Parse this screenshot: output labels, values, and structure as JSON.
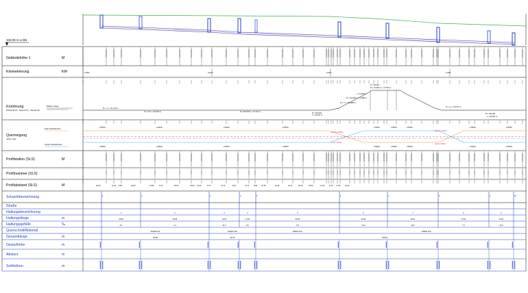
{
  "datum": "333.00 m ü.NN",
  "rows": {
    "gelaendehoehe": {
      "label": "Geländehöhe 1",
      "unit": "M"
    },
    "kilometrierung": {
      "label": "Kilometrierung",
      "unit": "KM"
    },
    "kruemmung": {
      "label": "Krümmung",
      "sub": "Hochpunkt (P) · Tiefpunkt (T) · Wende (W)",
      "legend": "Radius / Länge"
    },
    "querneigung": {
      "label": "Querneigung",
      "sub": "rechts / links",
      "legend_a": "linker Fahrbahnrand",
      "legend_b": "rechter Fahrbahnrand"
    },
    "profilstation": {
      "label": "Profilstation (SLS)",
      "unit": "M"
    },
    "profilnummer": {
      "label": "Profilnummer (SLS)"
    },
    "profilabstand": {
      "label": "Profilabstand (SLS)",
      "unit": "M"
    },
    "schacht": {
      "label": "Schachtbezeichnung"
    },
    "strasse": {
      "label": "Straße"
    },
    "haltung": {
      "label": "Haltungsbezeichnung"
    },
    "haltungslaenge": {
      "label": "Haltungslänge",
      "unit": "m"
    },
    "haltungsgefaelle": {
      "label": "Haltungsgefälle",
      "unit": "‰"
    },
    "querschnitt": {
      "label": "Querschnitt/Material"
    },
    "gesamtlaenge": {
      "label": "Gesamtlänge",
      "unit": "m"
    },
    "deckelhoehe": {
      "label": "Deckelhöhe",
      "unit": "m"
    },
    "absturz": {
      "label": "Absturz",
      "unit": "m"
    },
    "sohlhoehe": {
      "label": "Sohlhöhen",
      "unit": "m"
    }
  },
  "km_marks": [
    "0+000",
    "0+100",
    "0+200",
    "0+300"
  ],
  "kruemmung_labels": [
    "R = ∞ L = 51.142 m",
    "R = 174 L = 20.445 m",
    "R = 400.000 L = 70.727 m",
    "R = 400.000",
    "L = 24.827 m",
    "R = ∞ L = 24.386 m",
    "R = 120.000 L = 17.884 m",
    "L = 8.000 m",
    "R = 95.000",
    "R = 12.000 m L = 8.760 m",
    "R = ∞ L = 26.737 m",
    "R = 150.000",
    "L = 25.002 m"
  ],
  "querneigung_top": [
    "2.500%",
    "2.500%",
    "2.500%",
    "2.500%",
    "2.500%",
    "2.500%",
    "2.500%",
    "2.500%",
    "2.500%"
  ],
  "querneigung_bot": [
    "2.500%",
    "2.500%",
    "2.500%",
    "2.500%",
    "2.500%",
    "2.500%",
    "2.500%",
    "2.500%",
    "2.500%"
  ],
  "querneigung_red": [
    "Rechts 2.500%",
    "Links 2.500%",
    "Rechts 2.500%",
    "Links 2.500%"
  ],
  "profilabstand_values": [
    "20.00",
    "11.14",
    "8.86",
    "20.00",
    "14.59",
    "5.41",
    "20.00",
    "20.00",
    "13.30",
    "6.70",
    "10.11",
    "8.16",
    "16.71",
    "8.89",
    "10.36",
    "10.26",
    "10.11",
    "20.00",
    "20.00",
    "13.22",
    "6.78",
    "17.69",
    "19.02"
  ],
  "schacht_numbers": [
    "1",
    "2",
    "3",
    "4",
    "5",
    "6",
    "7",
    "8",
    "9",
    "10"
  ],
  "haltung_numbers": [
    "1",
    "2",
    "3",
    "4",
    "5",
    "6",
    "7",
    "8",
    "9"
  ],
  "haltungslaenge_values": [
    "38.83",
    "56.85",
    "20.60",
    "14.34",
    "66.96",
    "40.00",
    "40.00",
    "40.00",
    "33.62"
  ],
  "haltungsgefaelle_values": [
    "8.1",
    "3.1",
    "14.3",
    "9.6",
    "5.0",
    "10.0",
    "16.0",
    "7.2",
    "12.5"
  ],
  "querschnitt_values": [
    "DN400 STZ",
    "DN500 STZ",
    "DN500 PVC",
    "DN500 PVC"
  ],
  "gesamtlaenge_values": [
    "95.68",
    "35.16",
    "146.93"
  ],
  "colors": {
    "accent": "#1f3fbf",
    "terrain": "#38b24a",
    "magenta": "#e01c7a",
    "orange": "#e39a2b",
    "cyan": "#3cb7e0"
  }
}
